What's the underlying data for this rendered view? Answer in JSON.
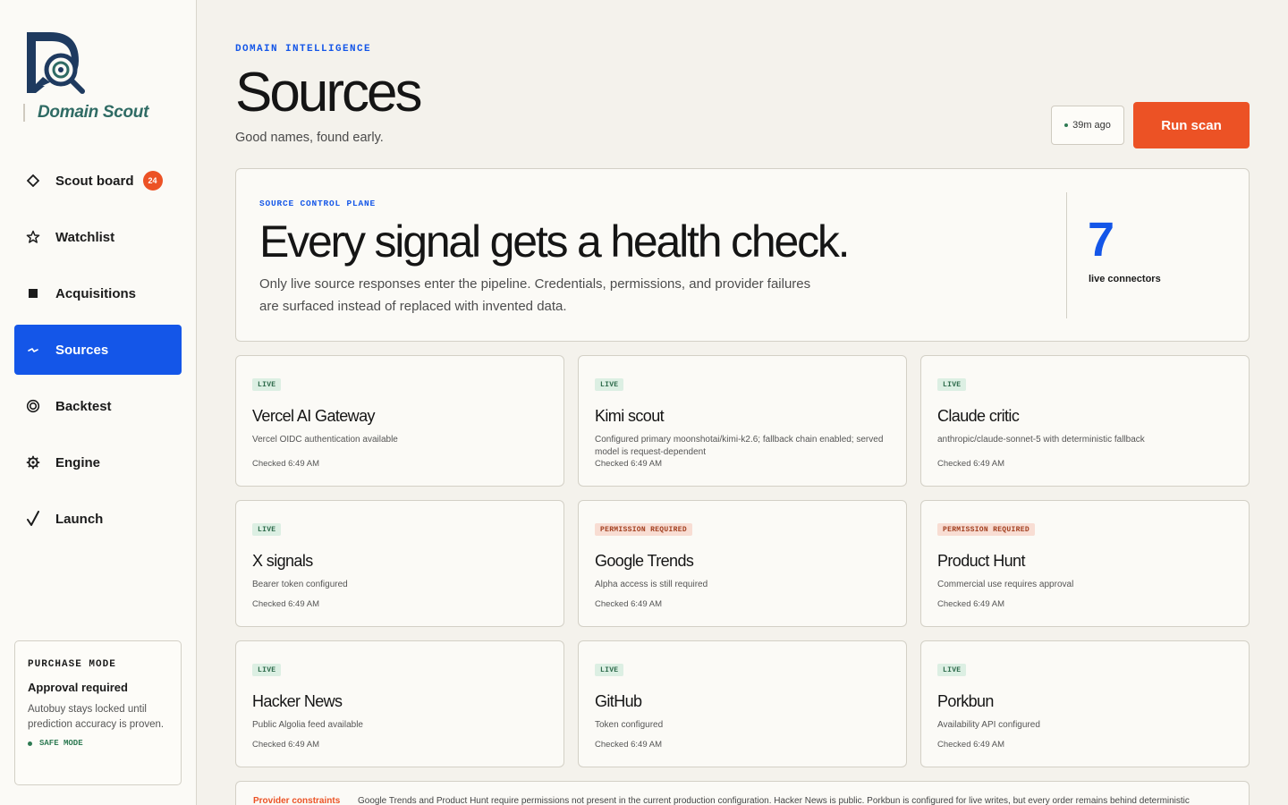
{
  "brand": {
    "name": "Domain Scout"
  },
  "nav": {
    "items": [
      {
        "label": "Scout board",
        "icon": "diamond-icon",
        "badge": "24"
      },
      {
        "label": "Watchlist",
        "icon": "star-icon"
      },
      {
        "label": "Acquisitions",
        "icon": "square-icon"
      },
      {
        "label": "Sources",
        "icon": "signal-icon",
        "active": true
      },
      {
        "label": "Backtest",
        "icon": "target-icon"
      },
      {
        "label": "Engine",
        "icon": "gear-icon"
      },
      {
        "label": "Launch",
        "icon": "check-icon"
      }
    ]
  },
  "purchase": {
    "eyebrow": "PURCHASE MODE",
    "title": "Approval required",
    "description": "Autobuy stays locked until prediction accuracy is proven.",
    "status": "SAFE MODE"
  },
  "header": {
    "eyebrow": "DOMAIN INTELLIGENCE",
    "title": "Sources",
    "subtitle": "Good names, found early.",
    "last_scan": "39m ago",
    "run_label": "Run scan"
  },
  "hero": {
    "eyebrow": "SOURCE CONTROL PLANE",
    "title": "Every signal gets a health check.",
    "description": "Only live source responses enter the pipeline. Credentials, permissions, and provider failures are surfaced instead of replaced with invented data.",
    "count": "7",
    "count_label": "live connectors"
  },
  "sources": [
    {
      "status": "LIVE",
      "name": "Vercel AI Gateway",
      "detail": "Vercel OIDC authentication available",
      "checked": "Checked 6:49 AM"
    },
    {
      "status": "LIVE",
      "name": "Kimi scout",
      "detail": "Configured primary moonshotai/kimi-k2.6; fallback chain enabled; served model is request-dependent",
      "checked": "Checked 6:49 AM"
    },
    {
      "status": "LIVE",
      "name": "Claude critic",
      "detail": "anthropic/claude-sonnet-5 with deterministic fallback",
      "checked": "Checked 6:49 AM"
    },
    {
      "status": "LIVE",
      "name": "X signals",
      "detail": "Bearer token configured",
      "checked": "Checked 6:49 AM"
    },
    {
      "status": "PERMISSION REQUIRED",
      "name": "Google Trends",
      "detail": "Alpha access is still required",
      "checked": "Checked 6:49 AM"
    },
    {
      "status": "PERMISSION REQUIRED",
      "name": "Product Hunt",
      "detail": "Commercial use requires approval",
      "checked": "Checked 6:49 AM"
    },
    {
      "status": "LIVE",
      "name": "Hacker News",
      "detail": "Public Algolia feed available",
      "checked": "Checked 6:49 AM"
    },
    {
      "status": "LIVE",
      "name": "GitHub",
      "detail": "Token configured",
      "checked": "Checked 6:49 AM"
    },
    {
      "status": "LIVE",
      "name": "Porkbun",
      "detail": "Availability API configured",
      "checked": "Checked 6:49 AM"
    }
  ],
  "constraints": {
    "label": "Provider constraints",
    "text": "Google Trends and Product Hunt require permissions not present in the current production configuration. Hacker News is public. Porkbun is configured for live writes, but every order remains behind deterministic"
  },
  "colors": {
    "accent": "#1456e8",
    "action": "#ec5225",
    "live": "#2e6b4b",
    "permission": "#a23f1f",
    "brand_text": "#2f6b64",
    "brand_mark": "#1e3a5f"
  }
}
